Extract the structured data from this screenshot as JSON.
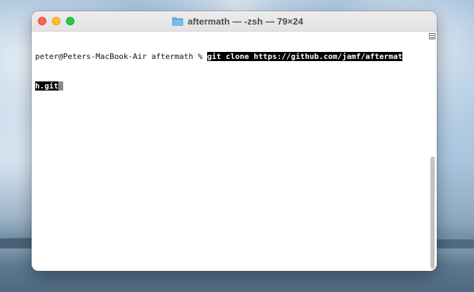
{
  "window": {
    "title": "aftermath — -zsh — 79×24",
    "folder_icon": "folder-icon",
    "traffic_lights": {
      "close": "#fe5f57",
      "minimize": "#febc2e",
      "zoom": "#28c840"
    }
  },
  "terminal": {
    "prompt": "peter@Peters-MacBook-Air aftermath % ",
    "command_line1": "git clone https://github.com/jamf/aftermat",
    "command_line2": "h.git",
    "selection_color": "#000000"
  }
}
